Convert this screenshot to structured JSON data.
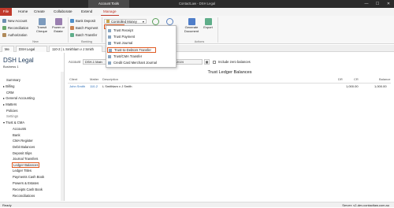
{
  "titlebar": {
    "context": "Account Tools",
    "title": "ContactLaw - DSH Legal",
    "minimize": "—",
    "maximize": "☐",
    "close": "✕"
  },
  "menu": {
    "file": "File",
    "items": [
      "Home",
      "Create",
      "Collaborate",
      "Extend"
    ],
    "active": "Manage"
  },
  "ribbon": {
    "new_account": "New Account",
    "reconciliation": "Reconciliation",
    "authorization": "Authorization",
    "transit_cheque": "Transit\nCheque",
    "power_of_estate": "Power or\nEstate",
    "group_new": "New",
    "bank_deposit": "Bank Deposit",
    "batch_payment": "Batch Payment",
    "batch_transfer": "Batch Transfer",
    "group_banking": "Banking",
    "controlled_money": "Controlled Money",
    "trust": "Trust",
    "generate_document": "Generate\nDocument",
    "export": "Export",
    "group_actions": "Actions"
  },
  "trust_menu": [
    "Trust Receipt",
    "Trust Payment",
    "Trust Journal",
    "Trust-to-Debtors Transfer",
    "Trust/CMA Transfer",
    "Credit Card Merchant Journal"
  ],
  "tabs": [
    "Me",
    "DSH Legal",
    "110-2 | L Smithlam v J Smith"
  ],
  "sidebar": {
    "firm": "DSH Legal",
    "business": "Business 1",
    "items": [
      "Summary",
      "Billing",
      "CRM",
      "General Accounting",
      "Matters",
      "Policies",
      "Settings",
      "Trust & CMA",
      "Accounts",
      "Bank",
      "CMA Register",
      "Debit Balances",
      "Deposit Slips",
      "Journal Transfers",
      "Ledger Balances",
      "Ledger Titles",
      "Payments Cash Book",
      "Powers & Estates",
      "Receipts Cash Book",
      "Reconciliations"
    ]
  },
  "main": {
    "account_label": "Account",
    "account_value": "DSH-1  Main",
    "date_value": "2024",
    "zero_balances": "Include zero balances",
    "panel_title": "Trust Ledger Balances",
    "columns": [
      "Client",
      "Matter",
      "Description",
      "DR",
      "CR",
      "Balance"
    ],
    "rows": [
      {
        "client": "John Smith",
        "matter": "110-2",
        "description": "L Smithlam v J Smith",
        "dr": "",
        "cr": "1,000.00",
        "balance": "1,000.00"
      }
    ]
  },
  "status": {
    "left": "Ready",
    "right": "Server: v2-dev.contactlaw.com.au"
  },
  "colors": {
    "accent": "#e05a22",
    "file": "#c0392b",
    "brand": "#1f3a5a"
  }
}
